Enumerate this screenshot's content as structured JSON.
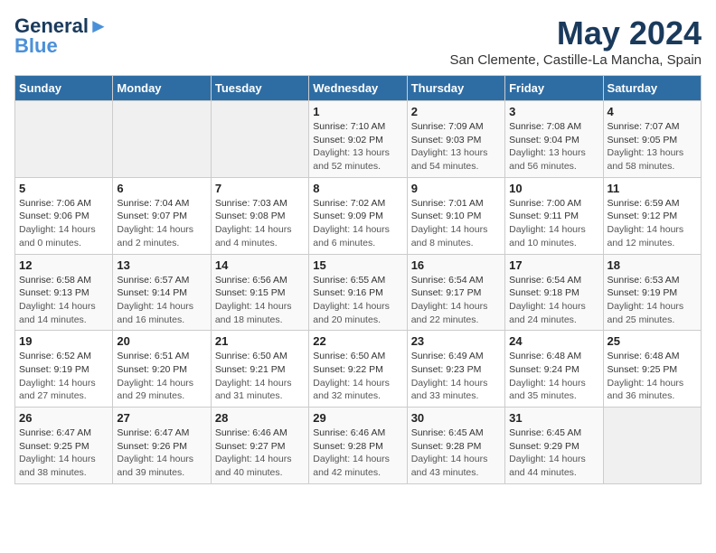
{
  "header": {
    "logo_line1": "General",
    "logo_line2": "Blue",
    "month_title": "May 2024",
    "location": "San Clemente, Castille-La Mancha, Spain"
  },
  "days_of_week": [
    "Sunday",
    "Monday",
    "Tuesday",
    "Wednesday",
    "Thursday",
    "Friday",
    "Saturday"
  ],
  "weeks": [
    [
      {
        "day": "",
        "info": ""
      },
      {
        "day": "",
        "info": ""
      },
      {
        "day": "",
        "info": ""
      },
      {
        "day": "1",
        "info": "Sunrise: 7:10 AM\nSunset: 9:02 PM\nDaylight: 13 hours and 52 minutes."
      },
      {
        "day": "2",
        "info": "Sunrise: 7:09 AM\nSunset: 9:03 PM\nDaylight: 13 hours and 54 minutes."
      },
      {
        "day": "3",
        "info": "Sunrise: 7:08 AM\nSunset: 9:04 PM\nDaylight: 13 hours and 56 minutes."
      },
      {
        "day": "4",
        "info": "Sunrise: 7:07 AM\nSunset: 9:05 PM\nDaylight: 13 hours and 58 minutes."
      }
    ],
    [
      {
        "day": "5",
        "info": "Sunrise: 7:06 AM\nSunset: 9:06 PM\nDaylight: 14 hours and 0 minutes."
      },
      {
        "day": "6",
        "info": "Sunrise: 7:04 AM\nSunset: 9:07 PM\nDaylight: 14 hours and 2 minutes."
      },
      {
        "day": "7",
        "info": "Sunrise: 7:03 AM\nSunset: 9:08 PM\nDaylight: 14 hours and 4 minutes."
      },
      {
        "day": "8",
        "info": "Sunrise: 7:02 AM\nSunset: 9:09 PM\nDaylight: 14 hours and 6 minutes."
      },
      {
        "day": "9",
        "info": "Sunrise: 7:01 AM\nSunset: 9:10 PM\nDaylight: 14 hours and 8 minutes."
      },
      {
        "day": "10",
        "info": "Sunrise: 7:00 AM\nSunset: 9:11 PM\nDaylight: 14 hours and 10 minutes."
      },
      {
        "day": "11",
        "info": "Sunrise: 6:59 AM\nSunset: 9:12 PM\nDaylight: 14 hours and 12 minutes."
      }
    ],
    [
      {
        "day": "12",
        "info": "Sunrise: 6:58 AM\nSunset: 9:13 PM\nDaylight: 14 hours and 14 minutes."
      },
      {
        "day": "13",
        "info": "Sunrise: 6:57 AM\nSunset: 9:14 PM\nDaylight: 14 hours and 16 minutes."
      },
      {
        "day": "14",
        "info": "Sunrise: 6:56 AM\nSunset: 9:15 PM\nDaylight: 14 hours and 18 minutes."
      },
      {
        "day": "15",
        "info": "Sunrise: 6:55 AM\nSunset: 9:16 PM\nDaylight: 14 hours and 20 minutes."
      },
      {
        "day": "16",
        "info": "Sunrise: 6:54 AM\nSunset: 9:17 PM\nDaylight: 14 hours and 22 minutes."
      },
      {
        "day": "17",
        "info": "Sunrise: 6:54 AM\nSunset: 9:18 PM\nDaylight: 14 hours and 24 minutes."
      },
      {
        "day": "18",
        "info": "Sunrise: 6:53 AM\nSunset: 9:19 PM\nDaylight: 14 hours and 25 minutes."
      }
    ],
    [
      {
        "day": "19",
        "info": "Sunrise: 6:52 AM\nSunset: 9:19 PM\nDaylight: 14 hours and 27 minutes."
      },
      {
        "day": "20",
        "info": "Sunrise: 6:51 AM\nSunset: 9:20 PM\nDaylight: 14 hours and 29 minutes."
      },
      {
        "day": "21",
        "info": "Sunrise: 6:50 AM\nSunset: 9:21 PM\nDaylight: 14 hours and 31 minutes."
      },
      {
        "day": "22",
        "info": "Sunrise: 6:50 AM\nSunset: 9:22 PM\nDaylight: 14 hours and 32 minutes."
      },
      {
        "day": "23",
        "info": "Sunrise: 6:49 AM\nSunset: 9:23 PM\nDaylight: 14 hours and 33 minutes."
      },
      {
        "day": "24",
        "info": "Sunrise: 6:48 AM\nSunset: 9:24 PM\nDaylight: 14 hours and 35 minutes."
      },
      {
        "day": "25",
        "info": "Sunrise: 6:48 AM\nSunset: 9:25 PM\nDaylight: 14 hours and 36 minutes."
      }
    ],
    [
      {
        "day": "26",
        "info": "Sunrise: 6:47 AM\nSunset: 9:25 PM\nDaylight: 14 hours and 38 minutes."
      },
      {
        "day": "27",
        "info": "Sunrise: 6:47 AM\nSunset: 9:26 PM\nDaylight: 14 hours and 39 minutes."
      },
      {
        "day": "28",
        "info": "Sunrise: 6:46 AM\nSunset: 9:27 PM\nDaylight: 14 hours and 40 minutes."
      },
      {
        "day": "29",
        "info": "Sunrise: 6:46 AM\nSunset: 9:28 PM\nDaylight: 14 hours and 42 minutes."
      },
      {
        "day": "30",
        "info": "Sunrise: 6:45 AM\nSunset: 9:28 PM\nDaylight: 14 hours and 43 minutes."
      },
      {
        "day": "31",
        "info": "Sunrise: 6:45 AM\nSunset: 9:29 PM\nDaylight: 14 hours and 44 minutes."
      },
      {
        "day": "",
        "info": ""
      }
    ]
  ]
}
